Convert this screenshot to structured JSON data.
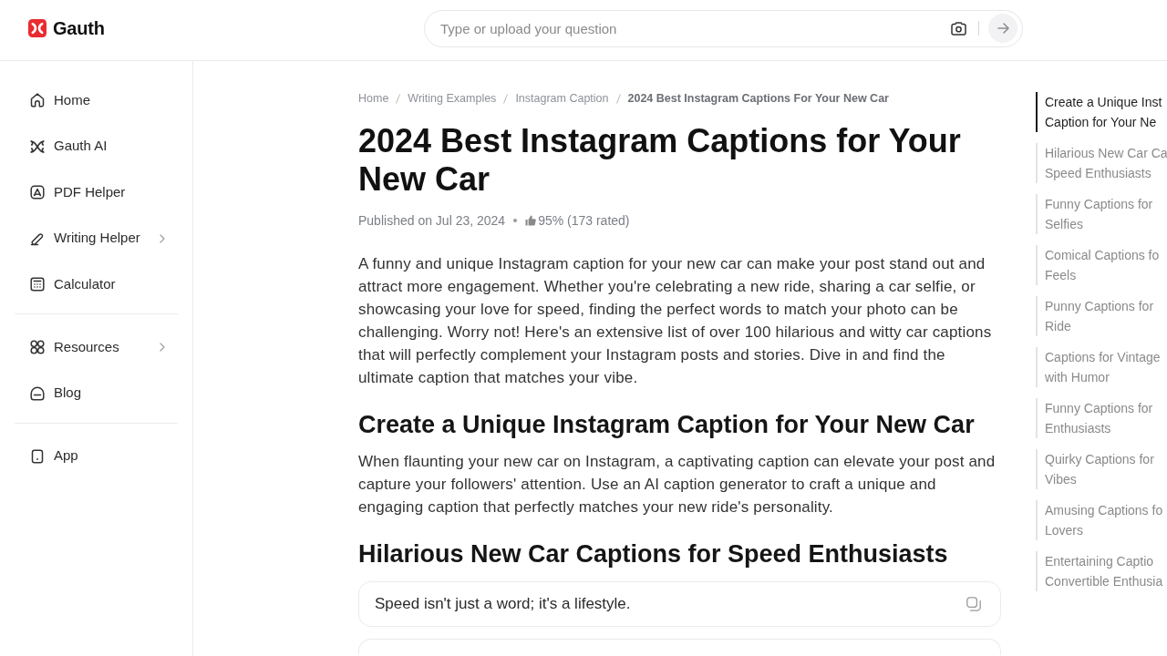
{
  "header": {
    "brand": "Gauth",
    "search": {
      "placeholder": "Type or upload your question"
    }
  },
  "sidebar": {
    "groups": [
      {
        "items": [
          {
            "label": "Home",
            "submenu": false
          },
          {
            "label": "Gauth AI",
            "submenu": false
          },
          {
            "label": "PDF Helper",
            "submenu": false
          },
          {
            "label": "Writing Helper",
            "submenu": true
          },
          {
            "label": "Calculator",
            "submenu": false
          }
        ]
      },
      {
        "items": [
          {
            "label": "Resources",
            "submenu": true
          },
          {
            "label": "Blog",
            "submenu": false
          }
        ]
      },
      {
        "items": [
          {
            "label": "App",
            "submenu": false
          }
        ]
      }
    ]
  },
  "breadcrumb": [
    {
      "label": "Home",
      "current": false
    },
    {
      "label": "Writing Examples",
      "current": false
    },
    {
      "label": "Instagram Caption",
      "current": false
    },
    {
      "label": "2024 Best Instagram Captions For Your New Car",
      "current": true
    }
  ],
  "article": {
    "title": "2024 Best Instagram Captions for Your New Car",
    "published": "Published on Jul 23, 2024",
    "rating": "95% (173 rated)",
    "intro": "A funny and unique Instagram caption for your new car can make your post stand out and attract more engagement. Whether you're celebrating a new ride, sharing a car selfie, or showcasing your love for speed, finding the perfect words to match your photo can be challenging. Worry not! Here's an extensive list of over 100 hilarious and witty car captions that will perfectly complement your Instagram posts and stories. Dive in and find the ultimate caption that matches your vibe.",
    "sections": [
      {
        "heading": "Create a Unique Instagram Caption for Your New Car",
        "body": "When flaunting your new car on Instagram, a captivating caption can elevate your post and capture your followers' attention. Use an AI caption generator to craft a unique and engaging caption that perfectly matches your new ride's personality."
      },
      {
        "heading": "Hilarious New Car Captions for Speed Enthusiasts",
        "captions": [
          {
            "text": "Speed isn't just a word; it's a lifestyle."
          }
        ]
      }
    ]
  },
  "toc": {
    "items": [
      {
        "lines": [
          "Create a Unique Inst",
          "Caption for Your Ne"
        ],
        "selected": true
      },
      {
        "lines": [
          "Hilarious New Car Ca",
          "Speed Enthusiasts"
        ],
        "selected": false
      },
      {
        "lines": [
          "Funny Captions for",
          "Selfies"
        ],
        "selected": false
      },
      {
        "lines": [
          "Comical Captions fo",
          "Feels"
        ],
        "selected": false
      },
      {
        "lines": [
          "Punny Captions for",
          "Ride"
        ],
        "selected": false
      },
      {
        "lines": [
          "Captions for Vintage",
          "with Humor"
        ],
        "selected": false
      },
      {
        "lines": [
          "Funny Captions for",
          "Enthusiasts"
        ],
        "selected": false
      },
      {
        "lines": [
          "Quirky Captions for",
          "Vibes"
        ],
        "selected": false
      },
      {
        "lines": [
          "Amusing Captions fo",
          "Lovers"
        ],
        "selected": false
      },
      {
        "lines": [
          "Entertaining Captio",
          "Convertible Enthusia"
        ],
        "selected": false
      }
    ]
  }
}
